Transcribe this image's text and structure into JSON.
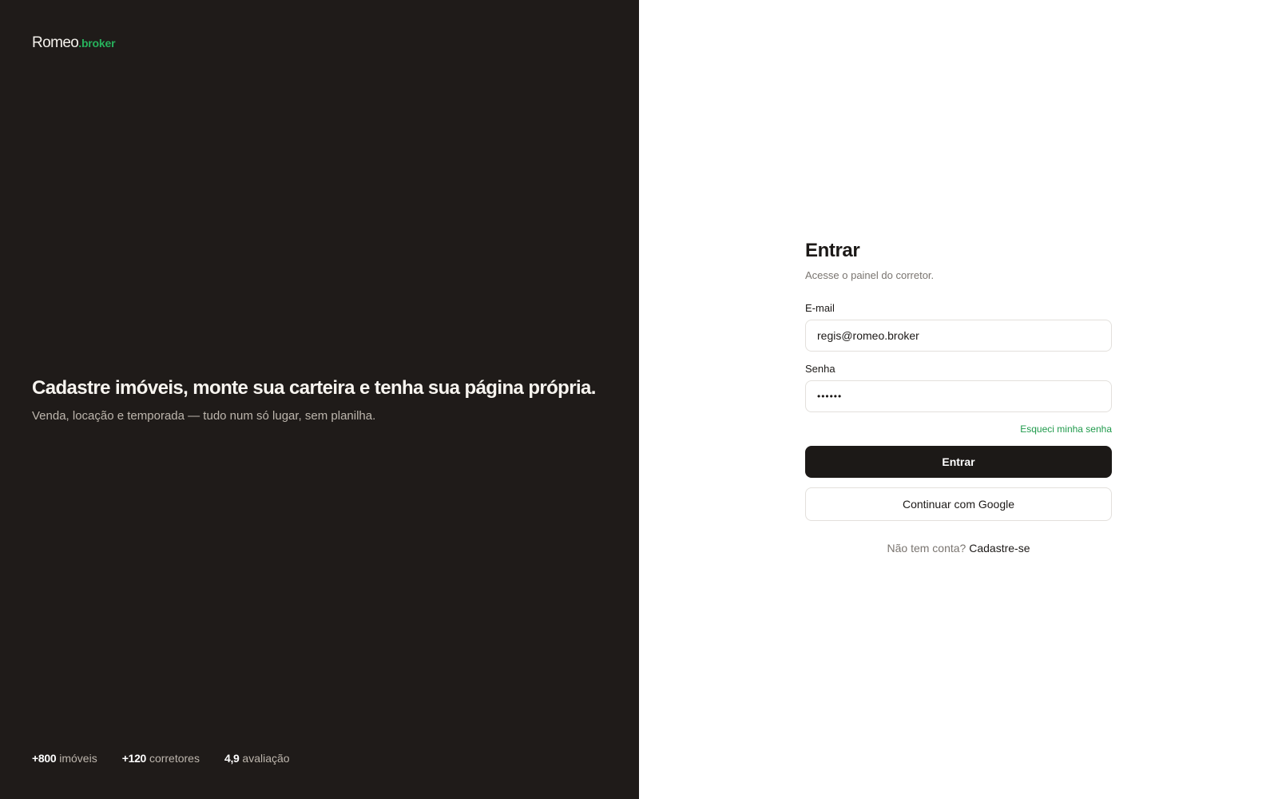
{
  "brand": {
    "name": "Romeo",
    "suffix": ".broker"
  },
  "hero": {
    "title": "Cadastre imóveis, monte sua carteira e tenha sua página própria.",
    "subtitle": "Venda, locação e temporada — tudo num só lugar, sem planilha."
  },
  "stats": [
    {
      "value": "+800",
      "label": "imóveis"
    },
    {
      "value": "+120",
      "label": "corretores"
    },
    {
      "value": "4,9",
      "label": "avaliação"
    }
  ],
  "login": {
    "title": "Entrar",
    "subtitle": "Acesse o painel do corretor.",
    "email_label": "E-mail",
    "email_value": "regis@romeo.broker",
    "password_label": "Senha",
    "password_value": "••••••",
    "forgot_label": "Esqueci minha senha",
    "submit_label": "Entrar",
    "google_label": "Continuar com Google",
    "signup_prompt": "Não tem conta?",
    "signup_label": "Cadastre-se"
  },
  "colors": {
    "panel_dark": "#1f1b19",
    "accent_green": "#27b25c",
    "button_dark": "#1c1917"
  }
}
